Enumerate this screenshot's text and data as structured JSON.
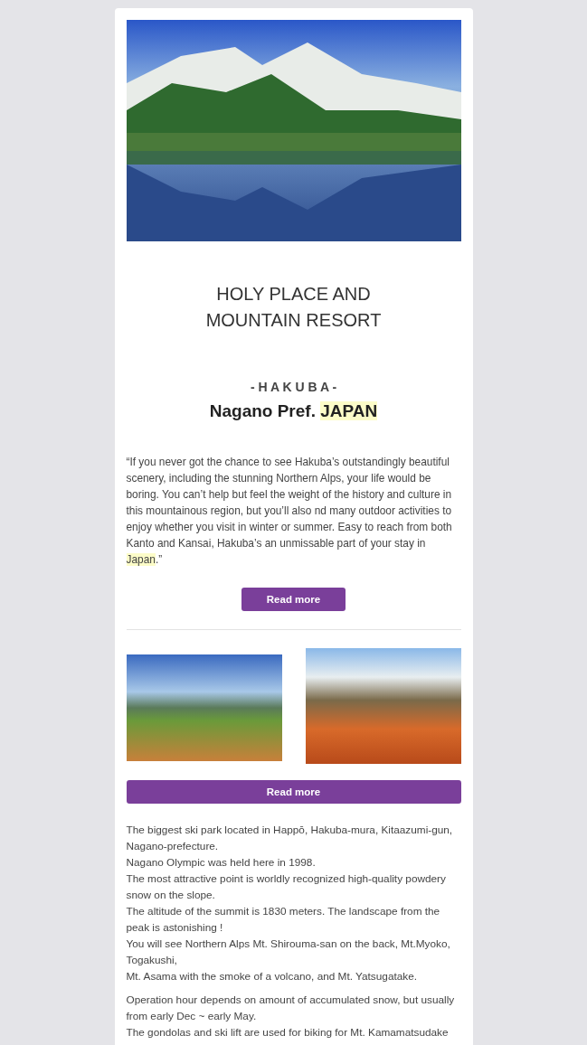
{
  "title_lines": [
    "HOLY PLACE AND",
    "MOUNTAIN RESORT"
  ],
  "subtitle": "- H A K U B A -",
  "headline": [
    {
      "text": "Nagano Pref. ",
      "highlighted": false
    },
    {
      "text": "JAPAN",
      "highlighted": true
    }
  ],
  "quote": [
    {
      "text": "“If you never got the chance to see Hakuba’s outstandingly beautiful scenery, including the stunning Northern Alps, your life would be boring. You can’t help but feel the weight of the history and culture in this mountainous region, but you’ll also nd many outdoor activities to enjoy whether you visit in winter or summer. Easy to reach from both Kanto and Kansai, Hakuba’s an unmissable part of your stay in ",
      "highlighted": false
    },
    {
      "text": "Japan",
      "highlighted": true
    },
    {
      "text": ".”",
      "highlighted": false
    }
  ],
  "buttons": [
    {
      "label": "Read more",
      "kind": "compact"
    },
    {
      "label": "Read more",
      "kind": "wide"
    }
  ],
  "paragraphs": [
    {
      "lines": [
        "The biggest ski park located in Happō, Hakuba-mura, Kitaazumi-gun, Nagano-prefecture.",
        "Nagano Olympic was held here in 1998.",
        "The most attractive point is worldly recognized high-quality powdery snow on the slope.",
        "The altitude of the summit is 1830 meters. The landscape from the peak is astonishing !",
        "You will see Northern Alps Mt. Shirouma-san on the back, Mt.Myoko, Togakushi,",
        "Mt. Asama with the smoke of a volcano, and Mt. Yatsugatake."
      ]
    },
    {
      "lines": [
        "Operation hour depends on amount of accumulated snow, but usually from early Dec ~ early May.",
        "The gondolas and ski lift are used for biking for Mt. Kamamatsudake"
      ]
    }
  ]
}
